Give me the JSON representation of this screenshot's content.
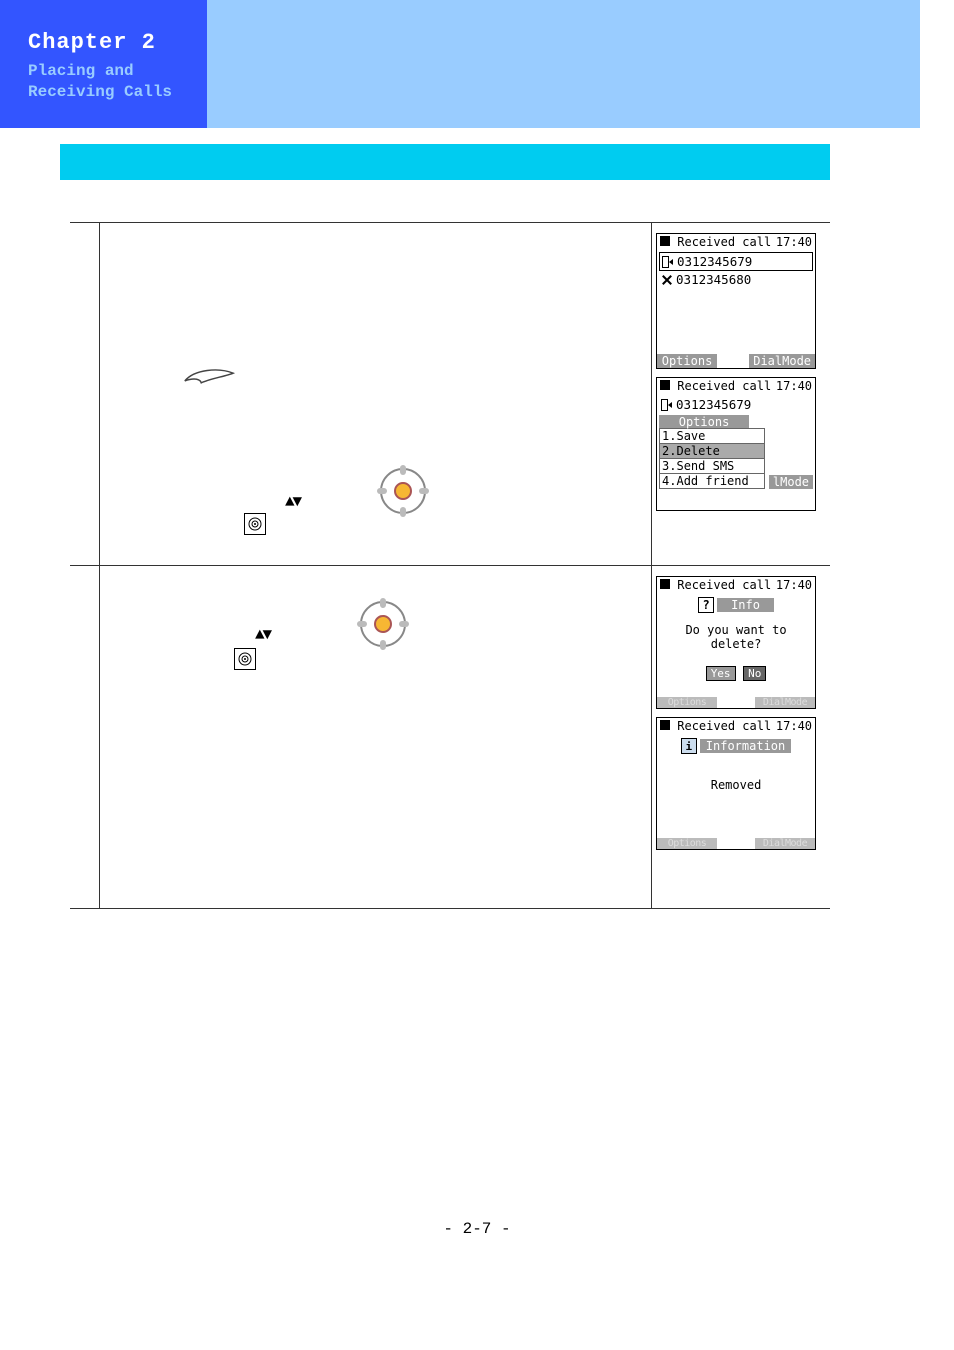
{
  "chapter": {
    "title": "Chapter 2",
    "subtitle": "Placing and Receiving Calls"
  },
  "screens": {
    "s1": {
      "title": "Received call",
      "time": "17:40",
      "entries": [
        {
          "icon": "incoming",
          "number": "0312345679"
        },
        {
          "icon": "missed",
          "number": "0312345680"
        }
      ],
      "soft_left": "Options",
      "soft_right": "DialMode"
    },
    "s2": {
      "title": "Received call",
      "time": "17:40",
      "top_entry": {
        "icon": "incoming",
        "number": "0312345679"
      },
      "menu_title": "Options",
      "menu_items": [
        "1.Save",
        "2.Delete",
        "3.Send SMS",
        "4.Add friend"
      ],
      "selected_index": 1,
      "soft_right_peek": "lMode"
    },
    "s3": {
      "title": "Received call",
      "time": "17:40",
      "badge": "Info",
      "message": "Do you want to delete?",
      "yes": "Yes",
      "no": "No",
      "soft_left": "Options",
      "soft_right": "DialMode"
    },
    "s4": {
      "title": "Received call",
      "time": "17:40",
      "badge": "Information",
      "message": "Removed",
      "soft_left": "Options",
      "soft_right": "DialMode"
    }
  },
  "page_number": "- 2-7 -"
}
